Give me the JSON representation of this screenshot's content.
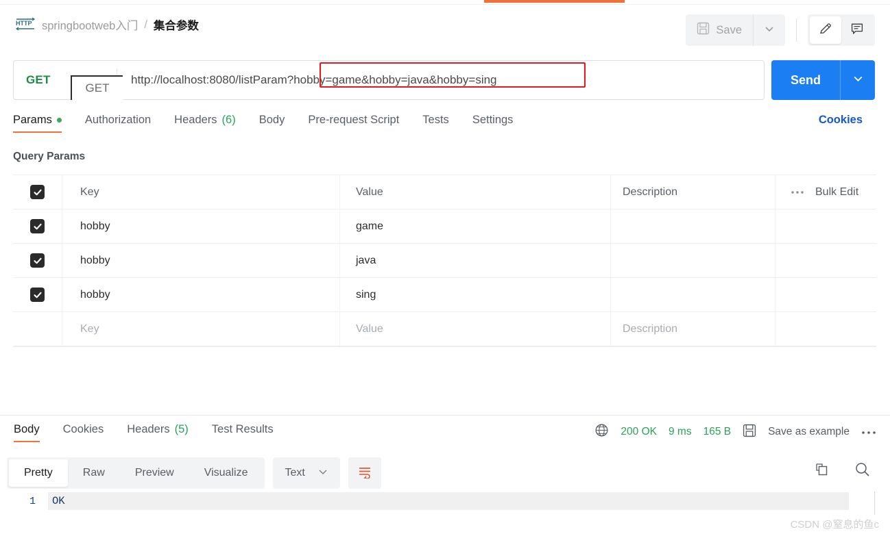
{
  "window": {
    "active_tab_indicator_color": "#f3703a"
  },
  "header": {
    "icon": "http-protocol-icon",
    "collection": "springbootweb入门",
    "separator": "/",
    "request_name": "集合参数",
    "save_label": "Save",
    "save_icon": "floppy-disk-icon",
    "caret_icon": "chevron-down-icon",
    "edit_icon": "pencil-icon",
    "comment_icon": "comment-icon"
  },
  "url_bar": {
    "method": "GET",
    "method_popup": "GET",
    "url_base": "http://localhost:8080/listParam",
    "url_query": "?hobby=game&hobby=java&hobby=sing",
    "highlight_color": "#e8191a",
    "send_label": "Send",
    "send_caret_icon": "chevron-down-icon",
    "send_color": "#1b7ef3"
  },
  "request_tabs": {
    "items": [
      {
        "label": "Params",
        "badge": "",
        "dot": true,
        "active": true
      },
      {
        "label": "Authorization",
        "badge": "",
        "dot": false,
        "active": false
      },
      {
        "label": "Headers",
        "badge": "(6)",
        "dot": false,
        "active": false
      },
      {
        "label": "Body",
        "badge": "",
        "dot": false,
        "active": false
      },
      {
        "label": "Pre-request Script",
        "badge": "",
        "dot": false,
        "active": false
      },
      {
        "label": "Tests",
        "badge": "",
        "dot": false,
        "active": false
      },
      {
        "label": "Settings",
        "badge": "",
        "dot": false,
        "active": false
      }
    ],
    "cookies_label": "Cookies"
  },
  "query_params": {
    "section_title": "Query Params",
    "columns": {
      "key": "Key",
      "value": "Value",
      "description": "Description"
    },
    "bulk_edit_label": "Bulk Edit",
    "more_icon": "ellipsis-icon",
    "rows": [
      {
        "checked": true,
        "key": "hobby",
        "value": "game",
        "description": ""
      },
      {
        "checked": true,
        "key": "hobby",
        "value": "java",
        "description": ""
      },
      {
        "checked": true,
        "key": "hobby",
        "value": "sing",
        "description": ""
      }
    ],
    "empty_row": {
      "key": "Key",
      "value": "Value",
      "description": "Description"
    }
  },
  "response": {
    "tabs": [
      {
        "label": "Body",
        "badge": "",
        "active": true
      },
      {
        "label": "Cookies",
        "badge": "",
        "active": false
      },
      {
        "label": "Headers",
        "badge": "(5)",
        "active": false
      },
      {
        "label": "Test Results",
        "badge": "",
        "active": false
      }
    ],
    "status": "200 OK",
    "time": "9 ms",
    "size": "165 B",
    "globe_icon": "globe-icon",
    "save_example_icon": "floppy-disk-icon",
    "save_example_label": "Save as example",
    "more_icon": "ellipsis-icon",
    "view_modes": [
      {
        "label": "Pretty",
        "active": true
      },
      {
        "label": "Raw",
        "active": false
      },
      {
        "label": "Preview",
        "active": false
      },
      {
        "label": "Visualize",
        "active": false
      }
    ],
    "format": "Text",
    "format_caret_icon": "chevron-down-icon",
    "wrap_icon": "word-wrap-icon",
    "copy_icon": "copy-icon",
    "search_icon": "search-icon",
    "body_lines": [
      {
        "number": "1",
        "text": "OK"
      }
    ]
  },
  "watermark": "CSDN @窒息的鱼c"
}
